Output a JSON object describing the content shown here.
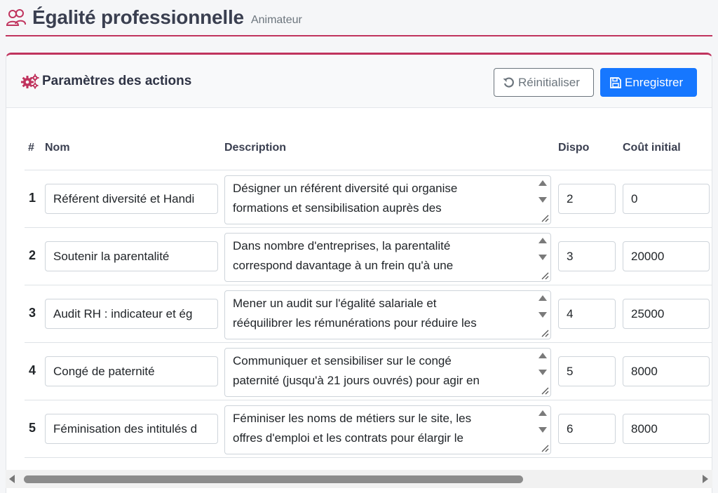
{
  "header": {
    "title": "Égalité professionnelle",
    "subtitle": "Animateur",
    "icon": "users-icon"
  },
  "card": {
    "title": "Paramètres des actions",
    "icon": "gears-icon",
    "reset_label": "Réinitialiser",
    "save_label": "Enregistrer"
  },
  "colors": {
    "accent": "#c0345e",
    "primary": "#1677ff"
  },
  "table": {
    "columns": {
      "num": "#",
      "name": "Nom",
      "description": "Description",
      "dispo": "Dispo",
      "cout": "Coût initial"
    },
    "rows": [
      {
        "num": "1",
        "name": "Référent diversité et Handi",
        "desc_line1": "Désigner un référent diversité qui organise",
        "desc_line2": "formations et sensibilisation auprès des",
        "dispo": "2",
        "cout": "0"
      },
      {
        "num": "2",
        "name": "Soutenir la parentalité",
        "desc_line1": "Dans nombre d'entreprises, la parentalité",
        "desc_line2": "correspond davantage à un frein qu'à une",
        "dispo": "3",
        "cout": "20000"
      },
      {
        "num": "3",
        "name": "Audit RH : indicateur et ég",
        "desc_line1": "Mener un audit sur l'égalité salariale et",
        "desc_line2": "rééquilibrer les rémunérations pour réduire les",
        "dispo": "4",
        "cout": "25000"
      },
      {
        "num": "4",
        "name": "Congé de paternité",
        "desc_line1": "Communiquer et sensibiliser sur le congé",
        "desc_line2": "paternité (jusqu'à 21 jours ouvrés) pour agir en",
        "dispo": "5",
        "cout": "8000"
      },
      {
        "num": "5",
        "name": "Féminisation des intitulés d",
        "desc_line1": "Féminiser les noms de métiers sur le site, les",
        "desc_line2": "offres d'emploi et les contrats pour élargir le",
        "dispo": "6",
        "cout": "8000"
      }
    ]
  }
}
